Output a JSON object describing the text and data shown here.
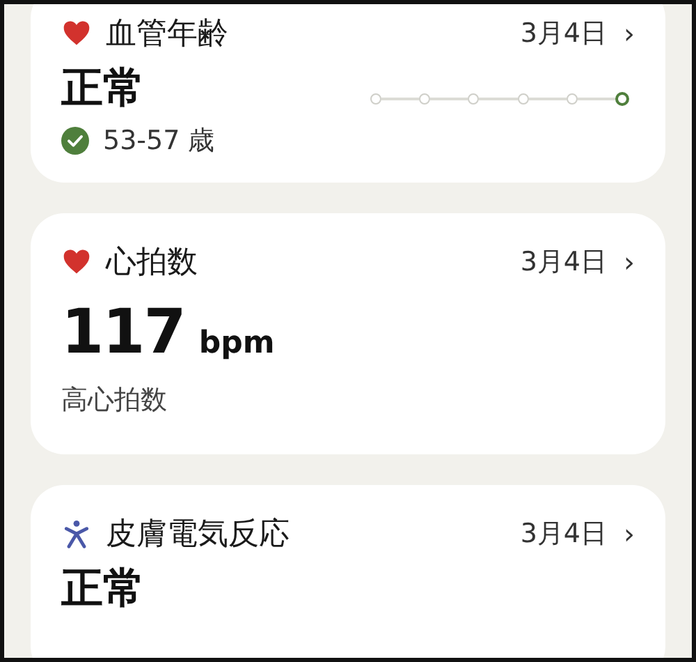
{
  "cards": [
    {
      "kind": "vascular_age",
      "title": "血管年齢",
      "date": "3月4日",
      "chevron": "›",
      "value": "正常",
      "status": {
        "text": "53-57 歳",
        "checked": true
      },
      "timeline": [
        {
          "selected": false
        },
        {
          "selected": false
        },
        {
          "selected": false
        },
        {
          "selected": false
        },
        {
          "selected": false
        },
        {
          "selected": true
        }
      ]
    },
    {
      "kind": "heart_rate",
      "title": "心拍数",
      "date": "3月4日",
      "chevron": "›",
      "value": "117",
      "unit": "bpm",
      "note": "高心拍数"
    },
    {
      "kind": "skin",
      "title": "皮膚電気反応",
      "date": "3月4日",
      "chevron": "›",
      "value": "正常"
    }
  ]
}
